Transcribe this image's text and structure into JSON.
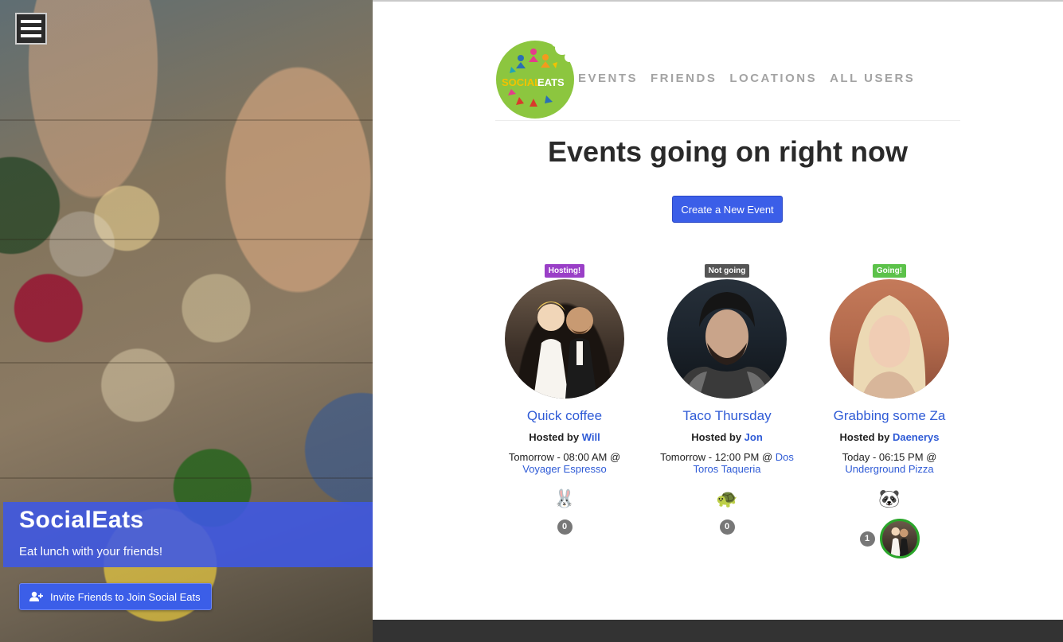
{
  "hero": {
    "title": "SocialEats",
    "subtitle": "Eat lunch with your friends!",
    "invite_label": "Invite Friends to Join Social Eats"
  },
  "logo": {
    "line1": "SOCIAL",
    "line2": "EATS"
  },
  "nav": [
    {
      "label": "EVENTS"
    },
    {
      "label": "FRIENDS"
    },
    {
      "label": "LOCATIONS"
    },
    {
      "label": "ALL USERS"
    }
  ],
  "page_title": "Events going on right now",
  "create_event_label": "Create a New Event",
  "colors": {
    "accent": "#3b5ee8",
    "link": "#2f5bd6",
    "hosting": "#9a3fc7",
    "not_going": "#555555",
    "going": "#5cc24a",
    "logo_green": "#8cc63f"
  },
  "events": [
    {
      "status": "Hosting!",
      "title": "Quick coffee",
      "hosted_by": "Hosted by",
      "host": "Will",
      "when": "Tomorrow - 08:00 AM @",
      "location": "Voyager Espresso",
      "emoji_icon": "rabbit-icon",
      "emoji": "🐰",
      "attendee_count": "0"
    },
    {
      "status": "Not going",
      "title": "Taco Thursday",
      "hosted_by": "Hosted by",
      "host": "Jon",
      "when": "Tomorrow - 12:00 PM @",
      "location": "Dos Toros Taqueria",
      "emoji_icon": "turtle-icon",
      "emoji": "🐢",
      "attendee_count": "0"
    },
    {
      "status": "Going!",
      "title": "Grabbing some Za",
      "hosted_by": "Hosted by",
      "host": "Daenerys",
      "when": "Today - 06:15 PM @",
      "location": "Underground Pizza",
      "emoji_icon": "panda-icon",
      "emoji": "🐼",
      "attendee_count": "1"
    }
  ]
}
